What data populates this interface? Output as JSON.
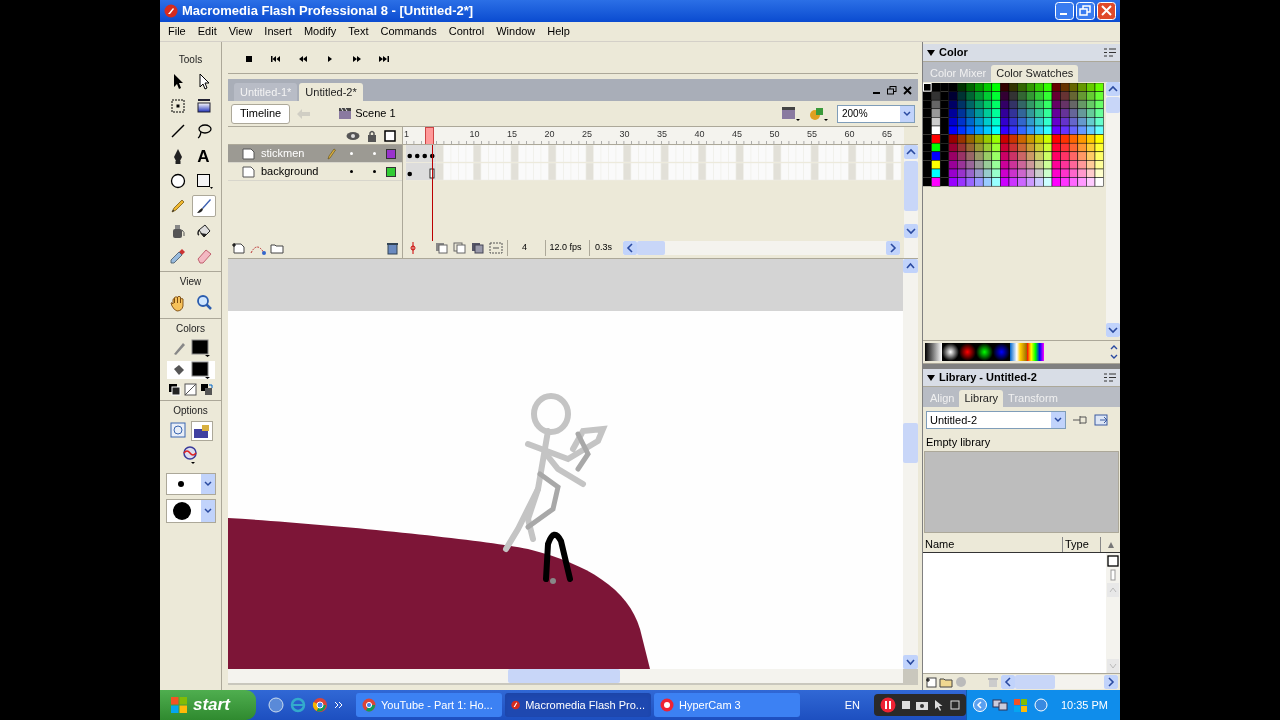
{
  "window": {
    "title": "Macromedia Flash Professional 8 - [Untitled-2*]"
  },
  "menu": [
    "File",
    "Edit",
    "View",
    "Insert",
    "Modify",
    "Text",
    "Commands",
    "Control",
    "Window",
    "Help"
  ],
  "tools_panel": {
    "title": "Tools",
    "tools": [
      {
        "kind": "arrow",
        "selected": false
      },
      {
        "kind": "subselect",
        "selected": false
      },
      {
        "kind": "transform",
        "selected": false
      },
      {
        "kind": "gradient",
        "selected": false
      },
      {
        "kind": "line",
        "selected": false
      },
      {
        "kind": "lasso",
        "selected": false
      },
      {
        "kind": "pen",
        "selected": false
      },
      {
        "kind": "text",
        "label": "A",
        "selected": false
      },
      {
        "kind": "oval",
        "selected": false
      },
      {
        "kind": "rectangle",
        "selected": false
      },
      {
        "kind": "pencil",
        "selected": false
      },
      {
        "kind": "brush",
        "selected": true
      },
      {
        "kind": "inkbottle",
        "selected": false
      },
      {
        "kind": "bucket",
        "selected": false
      },
      {
        "kind": "eyedropper",
        "selected": false
      },
      {
        "kind": "eraser",
        "selected": false
      }
    ],
    "view_title": "View",
    "view_tools": [
      {
        "kind": "hand",
        "selected": false
      },
      {
        "kind": "zoom",
        "selected": false
      }
    ],
    "colors_title": "Colors",
    "options_title": "Options"
  },
  "document_tabs": [
    {
      "label": "Untitled-1*",
      "selected": false
    },
    {
      "label": "Untitled-2*",
      "selected": true
    }
  ],
  "edit_bar": {
    "timeline_button": "Timeline",
    "scene": "Scene 1",
    "zoom": "200%"
  },
  "timeline": {
    "frame_numbers": [
      "1",
      "10",
      "15",
      "20",
      "25",
      "30",
      "35",
      "40",
      "45",
      "50",
      "55",
      "60",
      "65"
    ],
    "layers": [
      {
        "name": "stickmen",
        "selected": true,
        "color": "#9933cc"
      },
      {
        "name": "background",
        "selected": false,
        "color": "#33cc33"
      }
    ],
    "current_frame": "4",
    "frame_rate": "12.0 fps",
    "elapsed_time": "0.3s"
  },
  "color_panel": {
    "title": "Color",
    "tabs": [
      {
        "label": "Color Mixer",
        "selected": false
      },
      {
        "label": "Color Swatches",
        "selected": true
      }
    ]
  },
  "library_panel": {
    "title": "Library - Untitled-2",
    "tabs": [
      {
        "label": "Align",
        "selected": false
      },
      {
        "label": "Library",
        "selected": true
      },
      {
        "label": "Transform",
        "selected": false
      }
    ],
    "document": "Untitled-2",
    "status": "Empty library",
    "columns": [
      "Name",
      "Type"
    ]
  },
  "taskbar": {
    "start": "start",
    "items": [
      {
        "kind": "browser",
        "label": "YouTube - Part 1: Ho...",
        "selected": false
      },
      {
        "kind": "flash",
        "label": "Macromedia Flash Pro...",
        "selected": true
      },
      {
        "kind": "recorder",
        "label": "HyperCam 3",
        "selected": false
      }
    ],
    "language": "EN",
    "clock": "10:35 PM"
  }
}
